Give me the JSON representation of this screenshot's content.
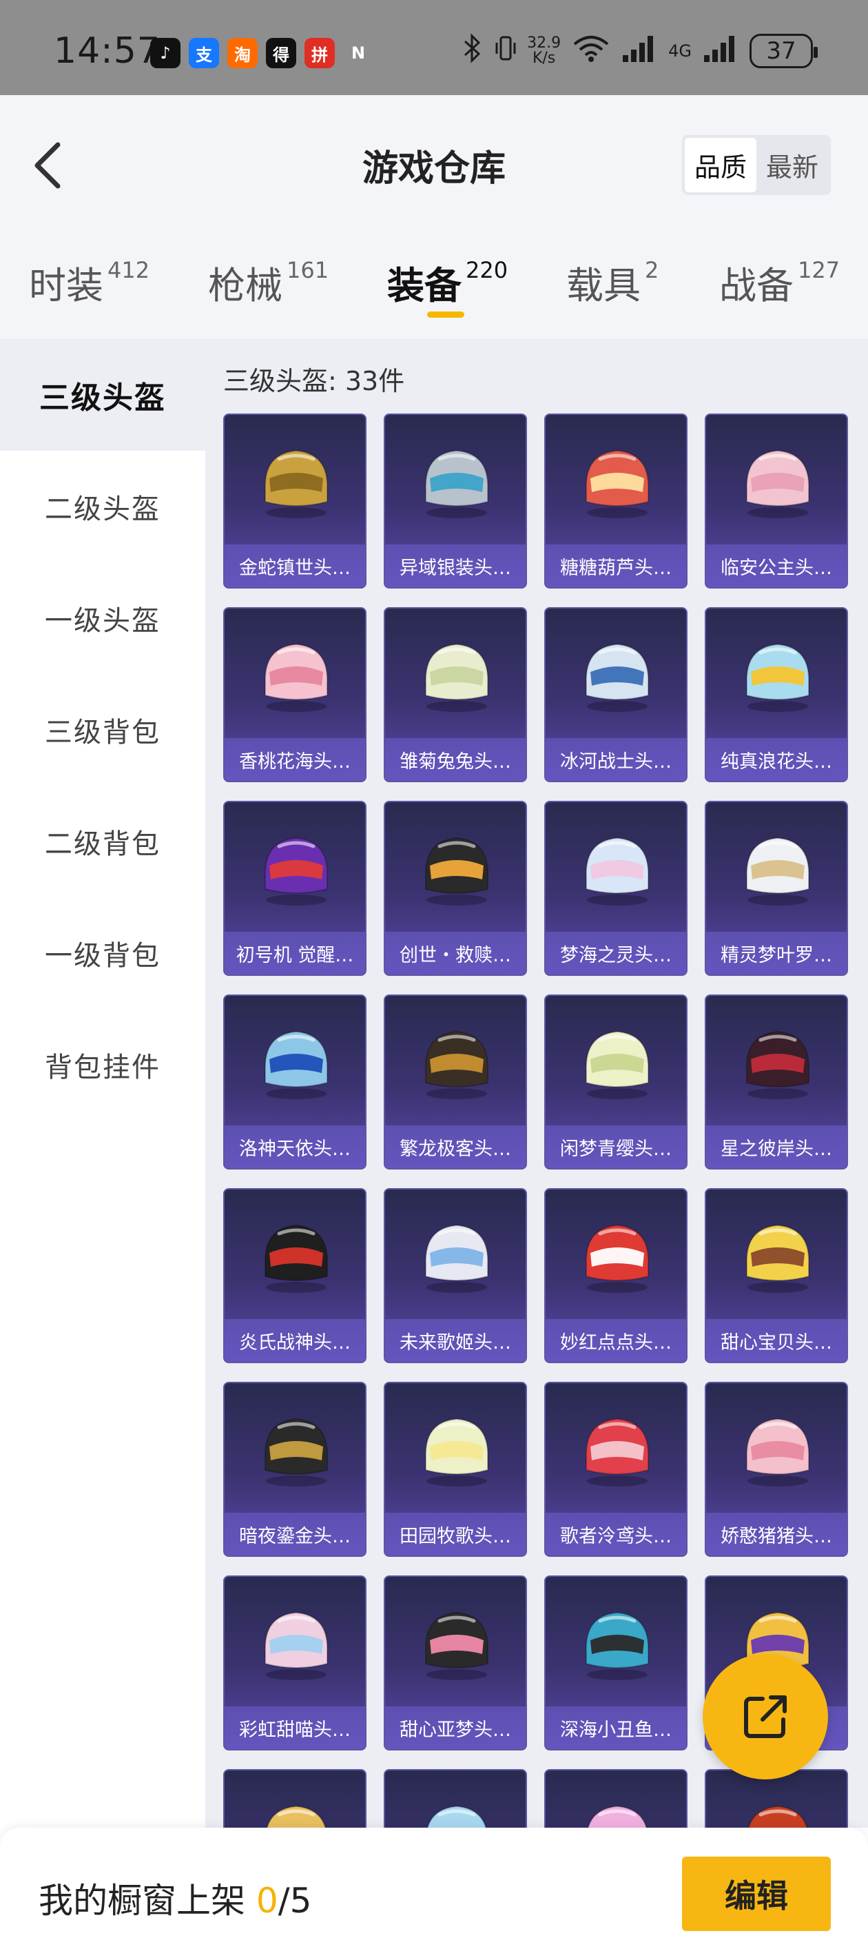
{
  "status_bar": {
    "time": "14:57",
    "net_speed_value": "32.9",
    "net_speed_unit": "K/s",
    "signal_label": "4G",
    "battery": "37",
    "apps": [
      {
        "icon": "tiktok-icon",
        "glyph": "♪",
        "color": "#111111"
      },
      {
        "icon": "alipay-icon",
        "glyph": "支",
        "color": "#1677ff"
      },
      {
        "icon": "taobao-icon",
        "glyph": "淘",
        "color": "#ff6a00"
      },
      {
        "icon": "dewu-icon",
        "glyph": "得",
        "color": "#111111"
      },
      {
        "icon": "pinduoduo-icon",
        "glyph": "拼",
        "color": "#e02e24"
      },
      {
        "icon": "nfc-icon",
        "glyph": "N",
        "color": "#8e8e8e"
      }
    ]
  },
  "header": {
    "title": "游戏仓库",
    "sort_options": [
      "品质",
      "最新"
    ],
    "sort_active": "品质"
  },
  "tabs": [
    {
      "label": "时装",
      "count": "412"
    },
    {
      "label": "枪械",
      "count": "161"
    },
    {
      "label": "装备",
      "count": "220",
      "active": true
    },
    {
      "label": "载具",
      "count": "2"
    },
    {
      "label": "战备",
      "count": "127"
    }
  ],
  "sidebar": {
    "items": [
      "三级头盔",
      "二级头盔",
      "一级头盔",
      "三级背包",
      "二级背包",
      "一级背包",
      "背包挂件"
    ],
    "active": "三级头盔"
  },
  "main": {
    "count_label": "三级头盔: 33件",
    "items": [
      {
        "name": "金蛇镇世头…",
        "color": "#c9a23f",
        "accent": "#8c6a1f"
      },
      {
        "name": "异域银装头…",
        "color": "#b8c2cc",
        "accent": "#3ba3c8"
      },
      {
        "name": "糖糖葫芦头…",
        "color": "#e35b4a",
        "accent": "#ffe0a0"
      },
      {
        "name": "临安公主头…",
        "color": "#f2c4cf",
        "accent": "#e8a0b4"
      },
      {
        "name": "香桃花海头…",
        "color": "#f6c2cf",
        "accent": "#e6869e"
      },
      {
        "name": "雏菊兔兔头…",
        "color": "#e8edcf",
        "accent": "#c8d6a0"
      },
      {
        "name": "冰河战士头…",
        "color": "#d6e4f2",
        "accent": "#3b6fb6"
      },
      {
        "name": "纯真浪花头…",
        "color": "#a9dcef",
        "accent": "#f4c430"
      },
      {
        "name": "初号机 觉醒…",
        "color": "#6a2fb0",
        "accent": "#e03a3a"
      },
      {
        "name": "创世・救赎…",
        "color": "#2a2a2a",
        "accent": "#f2a93b"
      },
      {
        "name": "梦海之灵头…",
        "color": "#d8e6f7",
        "accent": "#f0c8e0"
      },
      {
        "name": "精灵梦叶罗…",
        "color": "#eef0f4",
        "accent": "#d8c08a"
      },
      {
        "name": "洛神天依头…",
        "color": "#8ec6e8",
        "accent": "#1f4fb8"
      },
      {
        "name": "繁龙极客头…",
        "color": "#3a2f25",
        "accent": "#c8912f"
      },
      {
        "name": "闲梦青缨头…",
        "color": "#eef0c8",
        "accent": "#c8d690"
      },
      {
        "name": "星之彼岸头…",
        "color": "#3a1f2a",
        "accent": "#c02c3c"
      },
      {
        "name": "炎氏战神头…",
        "color": "#1f1f1f",
        "accent": "#d8342a"
      },
      {
        "name": "未来歌姬头…",
        "color": "#e6e8f2",
        "accent": "#7fb4e8"
      },
      {
        "name": "妙红点点头…",
        "color": "#e03a34",
        "accent": "#ffffff"
      },
      {
        "name": "甜心宝贝头…",
        "color": "#f2d24a",
        "accent": "#8a4a2a"
      },
      {
        "name": "暗夜鎏金头…",
        "color": "#2a2a2a",
        "accent": "#c8a040"
      },
      {
        "name": "田园牧歌头…",
        "color": "#eef0c8",
        "accent": "#f4e890"
      },
      {
        "name": "歌者泠鸢头…",
        "color": "#e2404a",
        "accent": "#f4c8d0"
      },
      {
        "name": "娇憨猪猪头…",
        "color": "#f4c0cc",
        "accent": "#e88aa0"
      },
      {
        "name": "彩虹甜喵头…",
        "color": "#f0d0e0",
        "accent": "#a0d0f0"
      },
      {
        "name": "甜心亚梦头…",
        "color": "#2a2a2a",
        "accent": "#f08aa8"
      },
      {
        "name": "深海小丑鱼…",
        "color": "#3aa8c8",
        "accent": "#2a2a2a"
      },
      {
        "name": "…",
        "color": "#f2c040",
        "accent": "#6a3ab0"
      },
      {
        "name": "",
        "color": "#e8c060",
        "accent": "#ffffff"
      },
      {
        "name": "",
        "color": "#a8d8f0",
        "accent": "#e8c060"
      },
      {
        "name": "",
        "color": "#f0b0e0",
        "accent": "#8a4ab0"
      },
      {
        "name": "",
        "color": "#c84020",
        "accent": "#e07030"
      }
    ]
  },
  "bottom": {
    "shelf_label": "我的橱窗上架",
    "shelf_current": "0",
    "shelf_total": "/5",
    "edit_label": "编辑"
  }
}
